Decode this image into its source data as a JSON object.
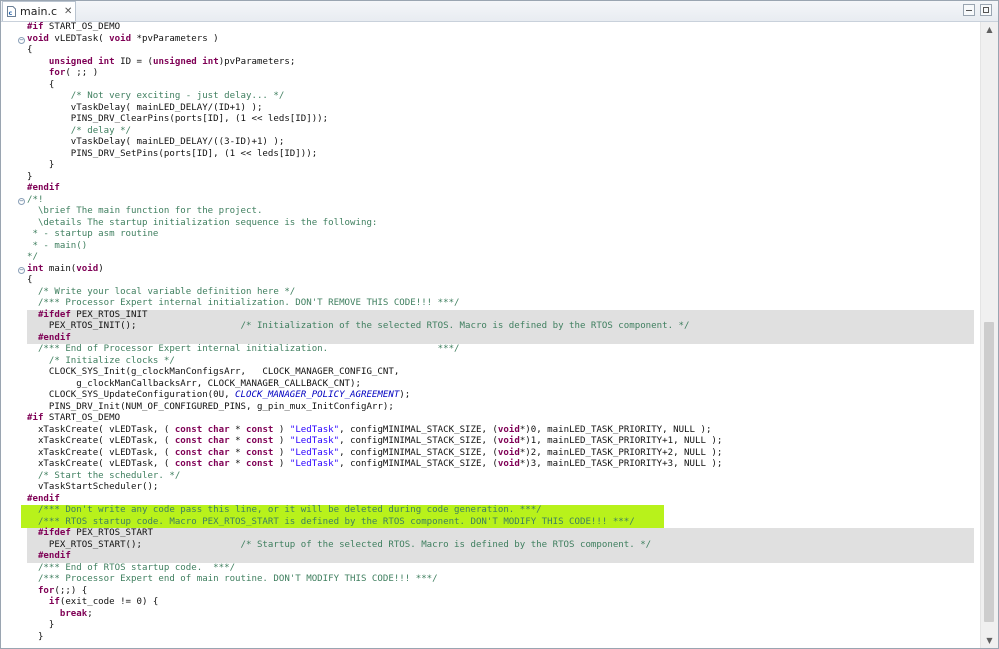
{
  "tab": {
    "title": "main.c",
    "close_symbol": "✕",
    "icon": "c-file-icon"
  },
  "window_controls": {
    "minimize": "minimize-icon",
    "maximize": "maximize-icon"
  },
  "highlight_colors": {
    "preprocessor_block": "#e0e0e0",
    "selection": "#b8f21b"
  },
  "lines": [
    "#if START_OS_DEMO",
    "void vLEDTask( void *pvParameters )",
    "{",
    "    unsigned int ID = (unsigned int)pvParameters;",
    "    for( ;; )",
    "    {",
    "        /* Not very exciting - just delay... */",
    "        vTaskDelay( mainLED_DELAY/(ID+1) );",
    "        PINS_DRV_ClearPins(ports[ID], (1 << leds[ID]));",
    "        /* delay */",
    "        vTaskDelay( mainLED_DELAY/((3-ID)+1) );",
    "        PINS_DRV_SetPins(ports[ID], (1 << leds[ID]));",
    "    }",
    "}",
    "#endif",
    "/*!",
    "  \\brief The main function for the project.",
    "  \\details The startup initialization sequence is the following:",
    " * - startup asm routine",
    " * - main()",
    "*/",
    "int main(void)",
    "{",
    "  /* Write your local variable definition here */",
    "  /*** Processor Expert internal initialization. DON'T REMOVE THIS CODE!!! ***/",
    "  #ifdef PEX_RTOS_INIT",
    "    PEX_RTOS_INIT();                   /* Initialization of the selected RTOS. Macro is defined by the RTOS component. */",
    "  #endif",
    "  /*** End of Processor Expert internal initialization.                    ***/",
    "    /* Initialize clocks */",
    "    CLOCK_SYS_Init(g_clockManConfigsArr,   CLOCK_MANAGER_CONFIG_CNT,",
    "         g_clockManCallbacksArr, CLOCK_MANAGER_CALLBACK_CNT);",
    "    CLOCK_SYS_UpdateConfiguration(0U, CLOCK_MANAGER_POLICY_AGREEMENT);",
    "    PINS_DRV_Init(NUM_OF_CONFIGURED_PINS, g_pin_mux_InitConfigArr);",
    "#if START_OS_DEMO",
    "  xTaskCreate( vLEDTask, ( const char * const ) \"LedTask\", configMINIMAL_STACK_SIZE, (void*)0, mainLED_TASK_PRIORITY, NULL );",
    "  xTaskCreate( vLEDTask, ( const char * const ) \"LedTask\", configMINIMAL_STACK_SIZE, (void*)1, mainLED_TASK_PRIORITY+1, NULL );",
    "  xTaskCreate( vLEDTask, ( const char * const ) \"LedTask\", configMINIMAL_STACK_SIZE, (void*)2, mainLED_TASK_PRIORITY+2, NULL );",
    "  xTaskCreate( vLEDTask, ( const char * const ) \"LedTask\", configMINIMAL_STACK_SIZE, (void*)3, mainLED_TASK_PRIORITY+3, NULL );",
    "  /* Start the scheduler. */",
    "  vTaskStartScheduler();",
    "#endif",
    "  /*** Don't write any code pass this line, or it will be deleted during code generation. ***/",
    "  /*** RTOS startup code. Macro PEX_RTOS_START is defined by the RTOS component. DON'T MODIFY THIS CODE!!! ***/",
    "  #ifdef PEX_RTOS_START",
    "    PEX_RTOS_START();                  /* Startup of the selected RTOS. Macro is defined by the RTOS component. */",
    "  #endif",
    "  /*** End of RTOS startup code.  ***/",
    "  /*** Processor Expert end of main routine. DON'T MODIFY THIS CODE!!! ***/",
    "  for(;;) {",
    "    if(exit_code != 0) {",
    "      break;",
    "    }",
    "  }"
  ],
  "scrollbar": {
    "up": "▲",
    "down": "▼"
  }
}
